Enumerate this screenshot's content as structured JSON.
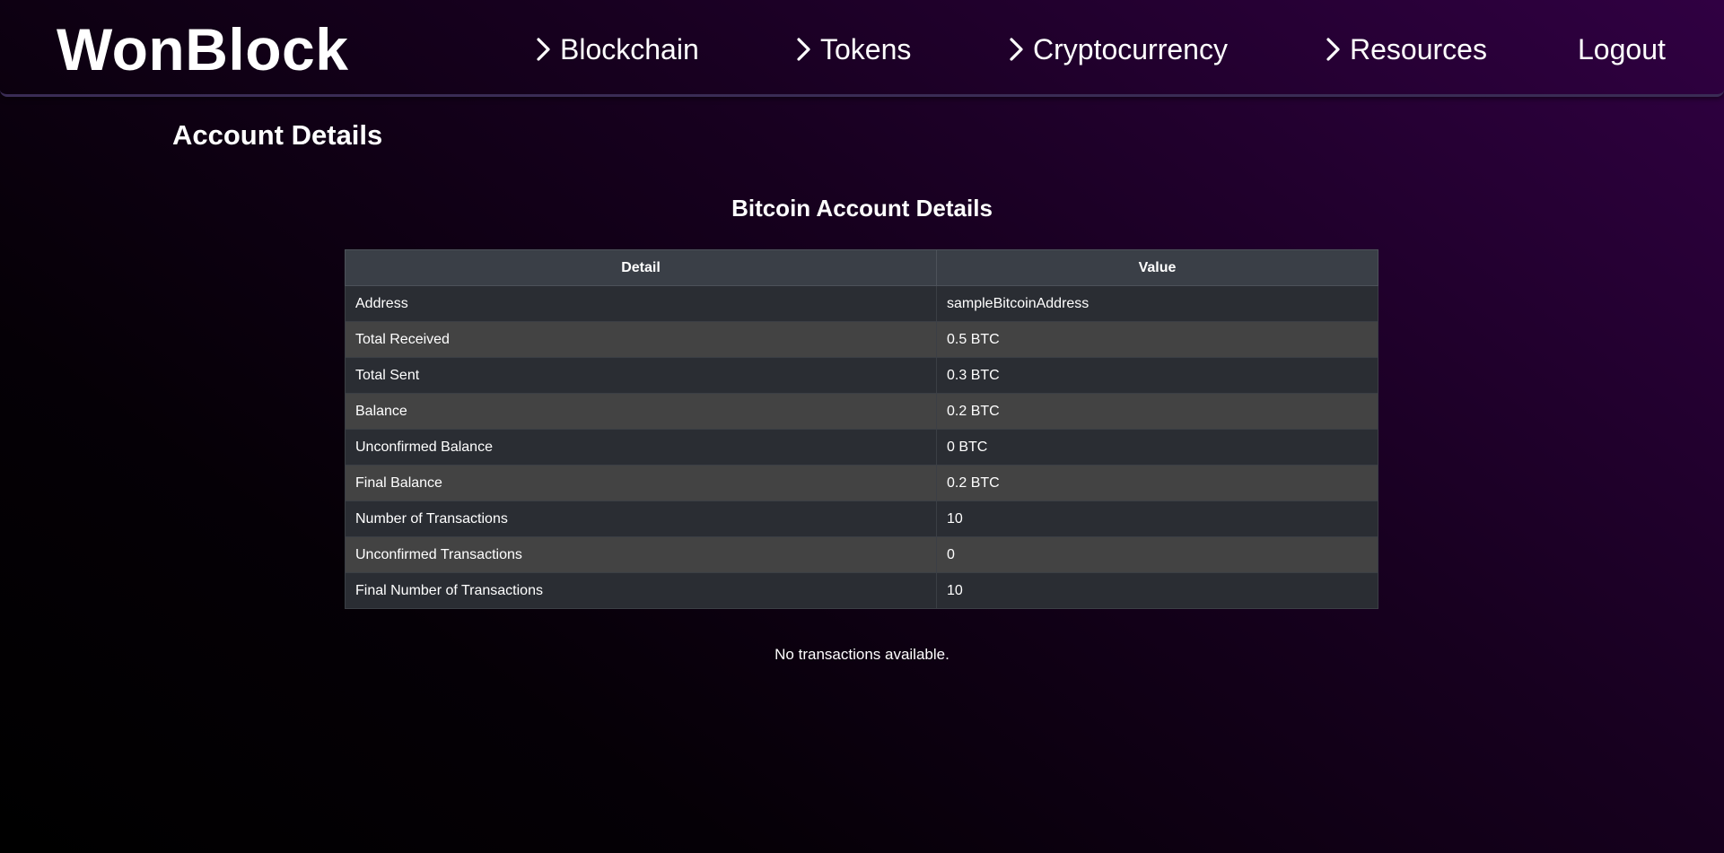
{
  "header": {
    "logo": "WonBlock",
    "nav": [
      {
        "label": "Blockchain"
      },
      {
        "label": "Tokens"
      },
      {
        "label": "Cryptocurrency"
      },
      {
        "label": "Resources"
      }
    ],
    "logout_label": "Logout",
    "chevron_icon": "chevron-right-icon"
  },
  "main": {
    "page_title": "Account Details",
    "section_title": "Bitcoin Account Details",
    "table": {
      "headers": [
        "Detail",
        "Value"
      ],
      "rows": [
        [
          "Address",
          "sampleBitcoinAddress"
        ],
        [
          "Total Received",
          "0.5 BTC"
        ],
        [
          "Total Sent",
          "0.3 BTC"
        ],
        [
          "Balance",
          "0.2 BTC"
        ],
        [
          "Unconfirmed Balance",
          "0 BTC"
        ],
        [
          "Final Balance",
          "0.2 BTC"
        ],
        [
          "Number of Transactions",
          "10"
        ],
        [
          "Unconfirmed Transactions",
          "0"
        ],
        [
          "Final Number of Transactions",
          "10"
        ]
      ]
    },
    "empty_transactions": "No transactions available."
  },
  "colors": {
    "background_top": "#300042",
    "background_bottom": "#000000",
    "table_header": "#3a3f47",
    "row_dark": "#2a2d33",
    "row_light": "#434343",
    "text": "#ffffff"
  }
}
